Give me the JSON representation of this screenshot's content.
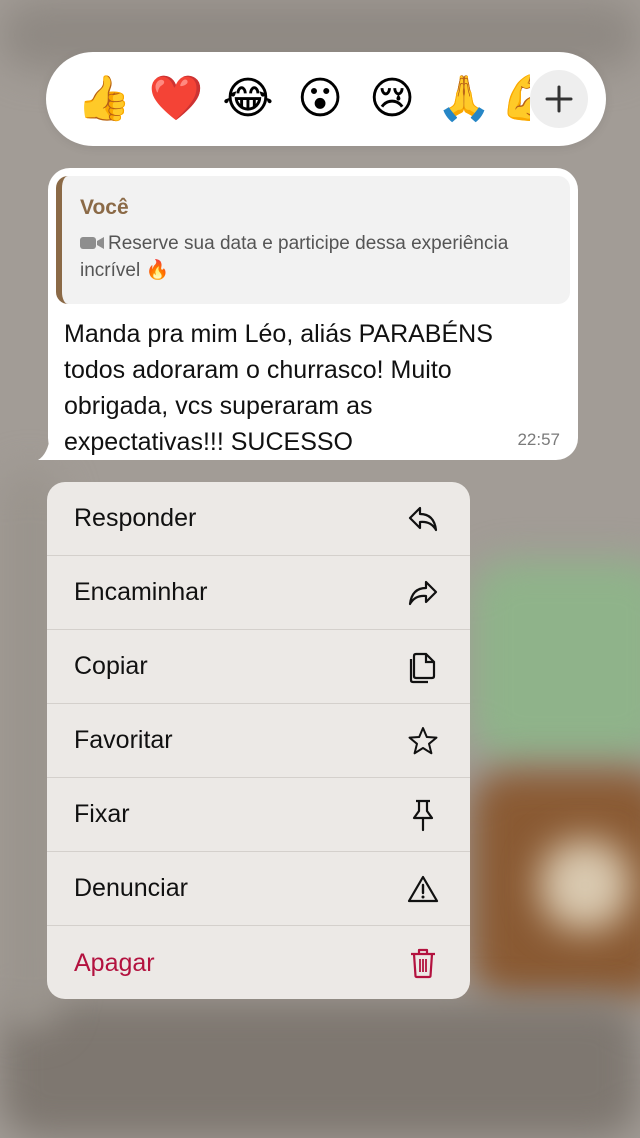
{
  "reactions": {
    "emojis": [
      "👍",
      "❤️",
      "😂",
      "😮",
      "😢",
      "🙏",
      "💪"
    ],
    "more_icon": "plus-icon"
  },
  "message": {
    "quote": {
      "author": "Você",
      "icon": "video-camera-icon",
      "text": "Reserve sua data e participe dessa experiência incrível 🔥"
    },
    "text": "Manda pra mim Léo, aliás PARABÉNS todos adoraram o churrasco! Muito obrigada, vcs superaram as expectativas!!! SUCESSO",
    "time": "22:57"
  },
  "menu": {
    "items": [
      {
        "label": "Responder",
        "icon": "reply-icon"
      },
      {
        "label": "Encaminhar",
        "icon": "forward-icon"
      },
      {
        "label": "Copiar",
        "icon": "copy-icon"
      },
      {
        "label": "Favoritar",
        "icon": "star-icon"
      },
      {
        "label": "Fixar",
        "icon": "pin-icon"
      },
      {
        "label": "Denunciar",
        "icon": "warning-icon"
      },
      {
        "label": "Apagar",
        "icon": "trash-icon"
      }
    ]
  },
  "colors": {
    "danger": "#b3123f",
    "quote_accent": "#8b6a47"
  }
}
